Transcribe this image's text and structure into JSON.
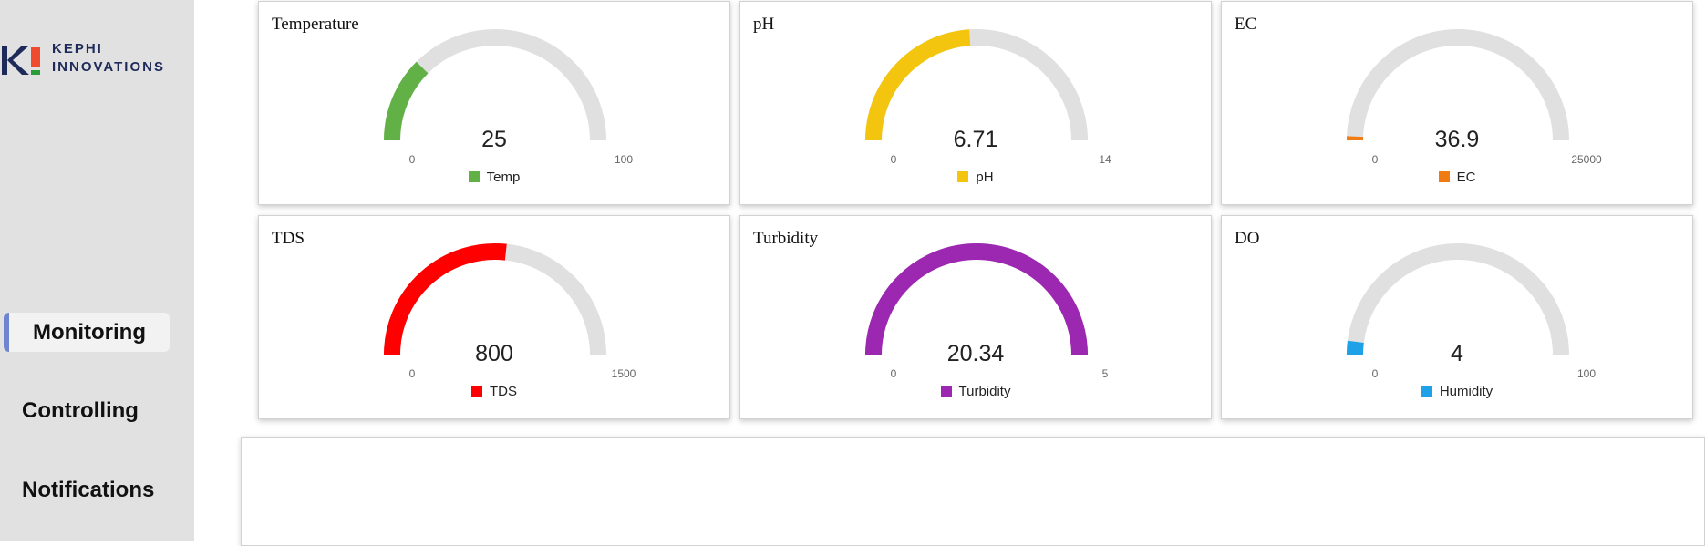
{
  "brand": {
    "line1": "KEPHI",
    "line2": "INNOVATIONS",
    "icon": "kephi-logo-icon"
  },
  "nav": {
    "items": [
      {
        "label": "Monitoring",
        "active": true
      },
      {
        "label": "Controlling",
        "active": false
      },
      {
        "label": "Notifications",
        "active": false
      }
    ]
  },
  "colors": {
    "track": "#e0e0e0",
    "nav_accent": "#6e84d0"
  },
  "gauges": [
    {
      "title": "Temperature",
      "value": 25,
      "display": "25",
      "min": 0,
      "max": 100,
      "min_label": "0",
      "max_label": "100",
      "legend": "Temp",
      "color": "#62b146"
    },
    {
      "title": "pH",
      "value": 6.71,
      "display": "6.71",
      "min": 0,
      "max": 14,
      "min_label": "0",
      "max_label": "14",
      "legend": "pH",
      "color": "#f3c50f"
    },
    {
      "title": "EC",
      "value": 36.9,
      "display": "36.9",
      "min": 0,
      "max": 25000,
      "min_label": "0",
      "max_label": "25000",
      "legend": "EC",
      "color": "#f07b12"
    },
    {
      "title": "TDS",
      "value": 800,
      "display": "800",
      "min": 0,
      "max": 1500,
      "min_label": "0",
      "max_label": "1500",
      "legend": "TDS",
      "color": "#ff0000"
    },
    {
      "title": "Turbidity",
      "value": 20.34,
      "display": "20.34",
      "min": 0,
      "max": 5,
      "min_label": "0",
      "max_label": "5",
      "legend": "Turbidity",
      "color": "#9c27b0"
    },
    {
      "title": "DO",
      "value": 4,
      "display": "4",
      "min": 0,
      "max": 100,
      "min_label": "0",
      "max_label": "100",
      "legend": "Humidity",
      "color": "#1ea1e6"
    }
  ]
}
